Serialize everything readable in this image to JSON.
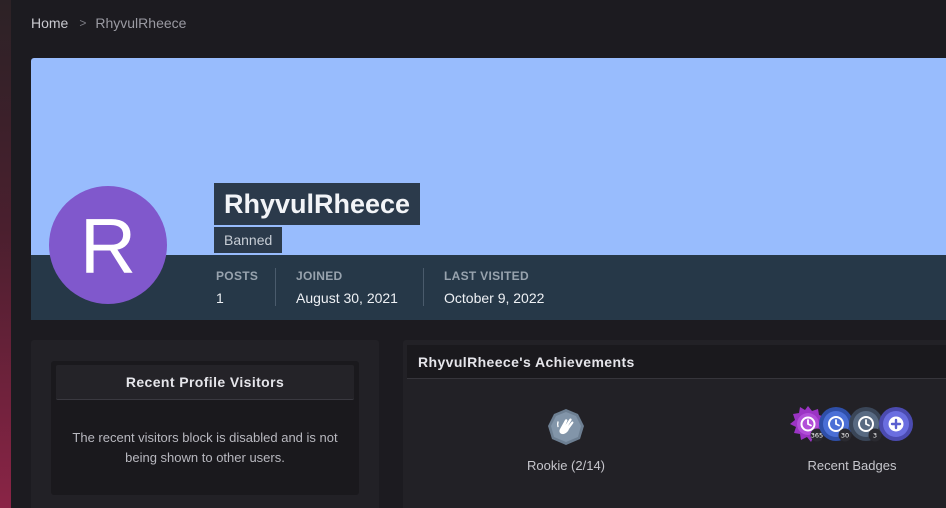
{
  "breadcrumb": {
    "home": "Home",
    "separator": ">",
    "current": "RhyvulRheece"
  },
  "profile": {
    "avatar_letter": "R",
    "username": "RhyvulRheece",
    "title": "Banned",
    "colors": {
      "cover": "#98bcfd",
      "avatar": "#8058cc",
      "stats_bar": "#263848"
    },
    "stats": [
      {
        "label": "POSTS",
        "value": "1"
      },
      {
        "label": "JOINED",
        "value": "August 30, 2021"
      },
      {
        "label": "LAST VISITED",
        "value": "October 9, 2022"
      }
    ]
  },
  "visitors": {
    "title": "Recent Profile Visitors",
    "message": "The recent visitors block is disabled and is not being shown to other users."
  },
  "achievements": {
    "title": "RhyvulRheece's Achievements",
    "rank": {
      "icon": "waving-hand-rank-icon",
      "label": "Rookie (2/14)"
    },
    "recent_badges": {
      "label": "Recent Badges",
      "badges": [
        {
          "icon": "clock-badge-icon",
          "count": "365"
        },
        {
          "icon": "clock-badge-icon",
          "count": "30"
        },
        {
          "icon": "clock-badge-icon",
          "count": "3"
        },
        {
          "icon": "plus-badge-icon",
          "count": ""
        }
      ]
    }
  }
}
